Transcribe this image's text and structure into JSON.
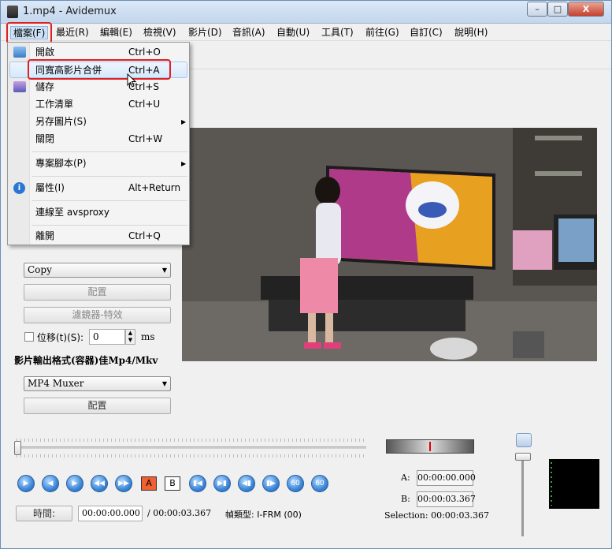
{
  "window": {
    "title": "1.mp4 - Avidemux",
    "buttons": [
      "–",
      "□",
      "X"
    ]
  },
  "menubar": [
    {
      "label": "檔案(F)",
      "active": true
    },
    {
      "label": "最近(R)"
    },
    {
      "label": "編輯(E)"
    },
    {
      "label": "檢視(V)"
    },
    {
      "label": "影片(D)"
    },
    {
      "label": "音訊(A)"
    },
    {
      "label": "自動(U)"
    },
    {
      "label": "工具(T)"
    },
    {
      "label": "前往(G)"
    },
    {
      "label": "自訂(C)"
    },
    {
      "label": "說明(H)"
    }
  ],
  "file_menu": {
    "items": [
      {
        "label": "開啟",
        "shortcut": "Ctrl+O",
        "icon": "folder-open-icon"
      },
      {
        "label": "同寬高影片合併",
        "shortcut": "Ctrl+A",
        "hover": true
      },
      {
        "label": "儲存",
        "shortcut": "Ctrl+S",
        "icon": "save-icon"
      },
      {
        "label": "工作清單",
        "shortcut": "Ctrl+U"
      },
      {
        "label": "另存圖片(S)",
        "shortcut": "",
        "submenu": true
      },
      {
        "label": "關閉",
        "shortcut": "Ctrl+W"
      },
      {
        "label": "專案腳本(P)",
        "shortcut": "",
        "submenu": true
      },
      {
        "label": "屬性(I)",
        "shortcut": "Alt+Return",
        "icon": "info-icon"
      },
      {
        "label": "連線至 avsproxy",
        "shortcut": ""
      },
      {
        "label": "離開",
        "shortcut": "Ctrl+Q"
      }
    ]
  },
  "left_panel": {
    "audio_codec": {
      "value": "Copy",
      "configure_label": "配置",
      "filters_label": "濾鏡器-特效",
      "shift_label": "位移(t)(S):",
      "shift_value": "0",
      "shift_unit": "ms"
    },
    "output_format": {
      "heading": "影片輸出格式(容器)佳Mp4/Mkv",
      "value": "MP4 Muxer",
      "configure_label": "配置"
    }
  },
  "playback": {
    "marker_a": "A",
    "marker_b": "B",
    "time_label": "時間:",
    "current_time": "00:00:00.000",
    "total_time": "/ 00:00:03.367",
    "frame_type": "幀類型: I-FRM (00)",
    "a_label": "A:",
    "a_time": "00:00:00.000",
    "b_label": "B:",
    "b_time": "00:00:03.367",
    "selection": "Selection: 00:00:03.367"
  },
  "colors": {
    "highlight_box": "#e02020",
    "menu_hover": "#d6e8fb",
    "button_blue": "#3b86d8"
  }
}
